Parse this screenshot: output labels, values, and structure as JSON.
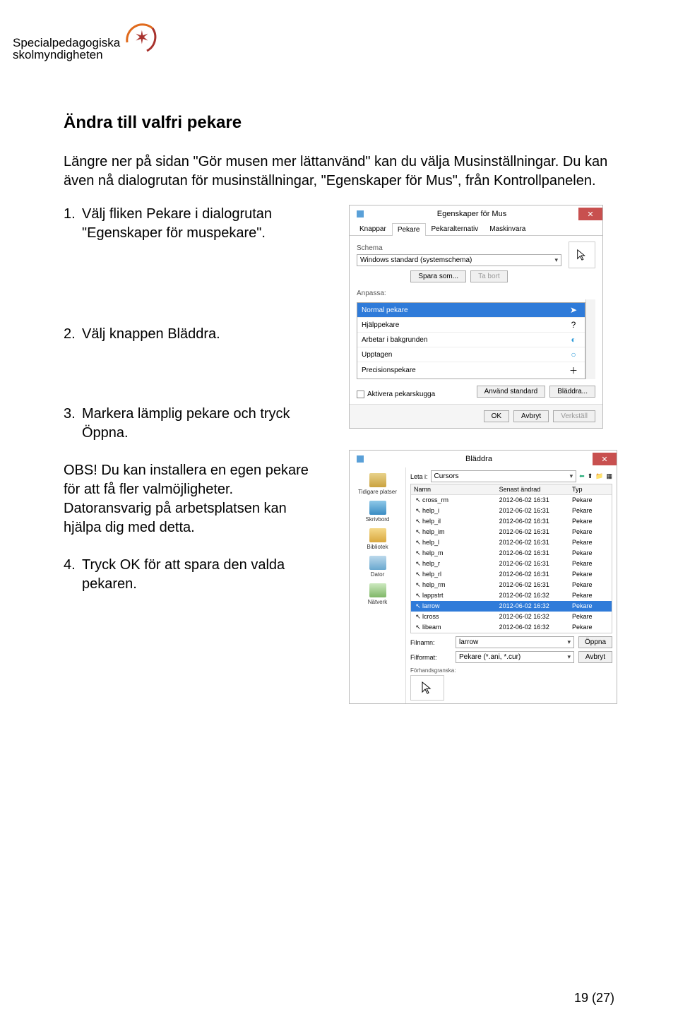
{
  "logo": {
    "line1": "Specialpedagogiska",
    "line2": "skolmyndigheten"
  },
  "title": "Ändra till valfri pekare",
  "intro": "Längre ner på sidan \"Gör musen mer lättanvänd\" kan du välja Musinställningar. Du kan även nå dialogrutan för musinställningar, \"Egenskaper för Mus\", från Kontrollpanelen.",
  "steps": {
    "s1": {
      "num": "1.",
      "text": "Välj fliken Pekare i dialogrutan \"Egenskaper för muspekare\"."
    },
    "s2": {
      "num": "2.",
      "text": "Välj knappen Bläddra."
    },
    "s3": {
      "num": "3.",
      "text": "Markera lämplig pekare och tryck Öppna."
    },
    "s4": {
      "num": "4.",
      "text": "Tryck OK för att spara den valda pekaren."
    }
  },
  "note": "OBS! Du kan installera en egen pekare för att få fler valmöjligheter. Datoransvarig på arbetsplatsen kan hjälpa dig med detta.",
  "footer": "19 (27)",
  "scr1": {
    "title": "Egenskaper för Mus",
    "tabs": {
      "t1": "Knappar",
      "t2": "Pekare",
      "t3": "Pekaralternativ",
      "t4": "Maskinvara"
    },
    "schema_label": "Schema",
    "schema_value": "Windows standard (systemschema)",
    "btn_save": "Spara som...",
    "btn_delete": "Ta bort",
    "anpassa": "Anpassa:",
    "rows": {
      "r1": "Normal pekare",
      "r2": "Hjälppekare",
      "r3": "Arbetar i bakgrunden",
      "r4": "Upptagen",
      "r5": "Precisionspekare"
    },
    "shadow": "Aktivera pekarskugga",
    "btn_default": "Använd standard",
    "btn_browse": "Bläddra...",
    "btn_ok": "OK",
    "btn_cancel": "Avbryt",
    "btn_apply": "Verkställ"
  },
  "scr2": {
    "title": "Bläddra",
    "leta_label": "Leta i:",
    "leta_value": "Cursors",
    "nav": {
      "recent": "Tidigare platser",
      "desk": "Skrivbord",
      "lib": "Bibliotek",
      "pc": "Dator",
      "net": "Nätverk"
    },
    "cols": {
      "name": "Namn",
      "date": "Senast ändrad",
      "type": "Typ"
    },
    "files": [
      {
        "n": "cross_rm",
        "d": "2012-06-02 16:31",
        "t": "Pekare"
      },
      {
        "n": "help_i",
        "d": "2012-06-02 16:31",
        "t": "Pekare"
      },
      {
        "n": "help_il",
        "d": "2012-06-02 16:31",
        "t": "Pekare"
      },
      {
        "n": "help_im",
        "d": "2012-06-02 16:31",
        "t": "Pekare"
      },
      {
        "n": "help_l",
        "d": "2012-06-02 16:31",
        "t": "Pekare"
      },
      {
        "n": "help_m",
        "d": "2012-06-02 16:31",
        "t": "Pekare"
      },
      {
        "n": "help_r",
        "d": "2012-06-02 16:31",
        "t": "Pekare"
      },
      {
        "n": "help_rl",
        "d": "2012-06-02 16:31",
        "t": "Pekare"
      },
      {
        "n": "help_rm",
        "d": "2012-06-02 16:31",
        "t": "Pekare"
      },
      {
        "n": "lappstrt",
        "d": "2012-06-02 16:32",
        "t": "Pekare"
      },
      {
        "n": "larrow",
        "d": "2012-06-02 16:32",
        "t": "Pekare"
      },
      {
        "n": "lcross",
        "d": "2012-06-02 16:32",
        "t": "Pekare"
      },
      {
        "n": "libeam",
        "d": "2012-06-02 16:32",
        "t": "Pekare"
      }
    ],
    "filnamn_label": "Filnamn:",
    "filnamn_value": "larrow",
    "filformat_label": "Filformat:",
    "filformat_value": "Pekare (*.ani, *.cur)",
    "btn_open": "Öppna",
    "btn_cancel": "Avbryt",
    "preview_label": "Förhandsgranska:"
  }
}
